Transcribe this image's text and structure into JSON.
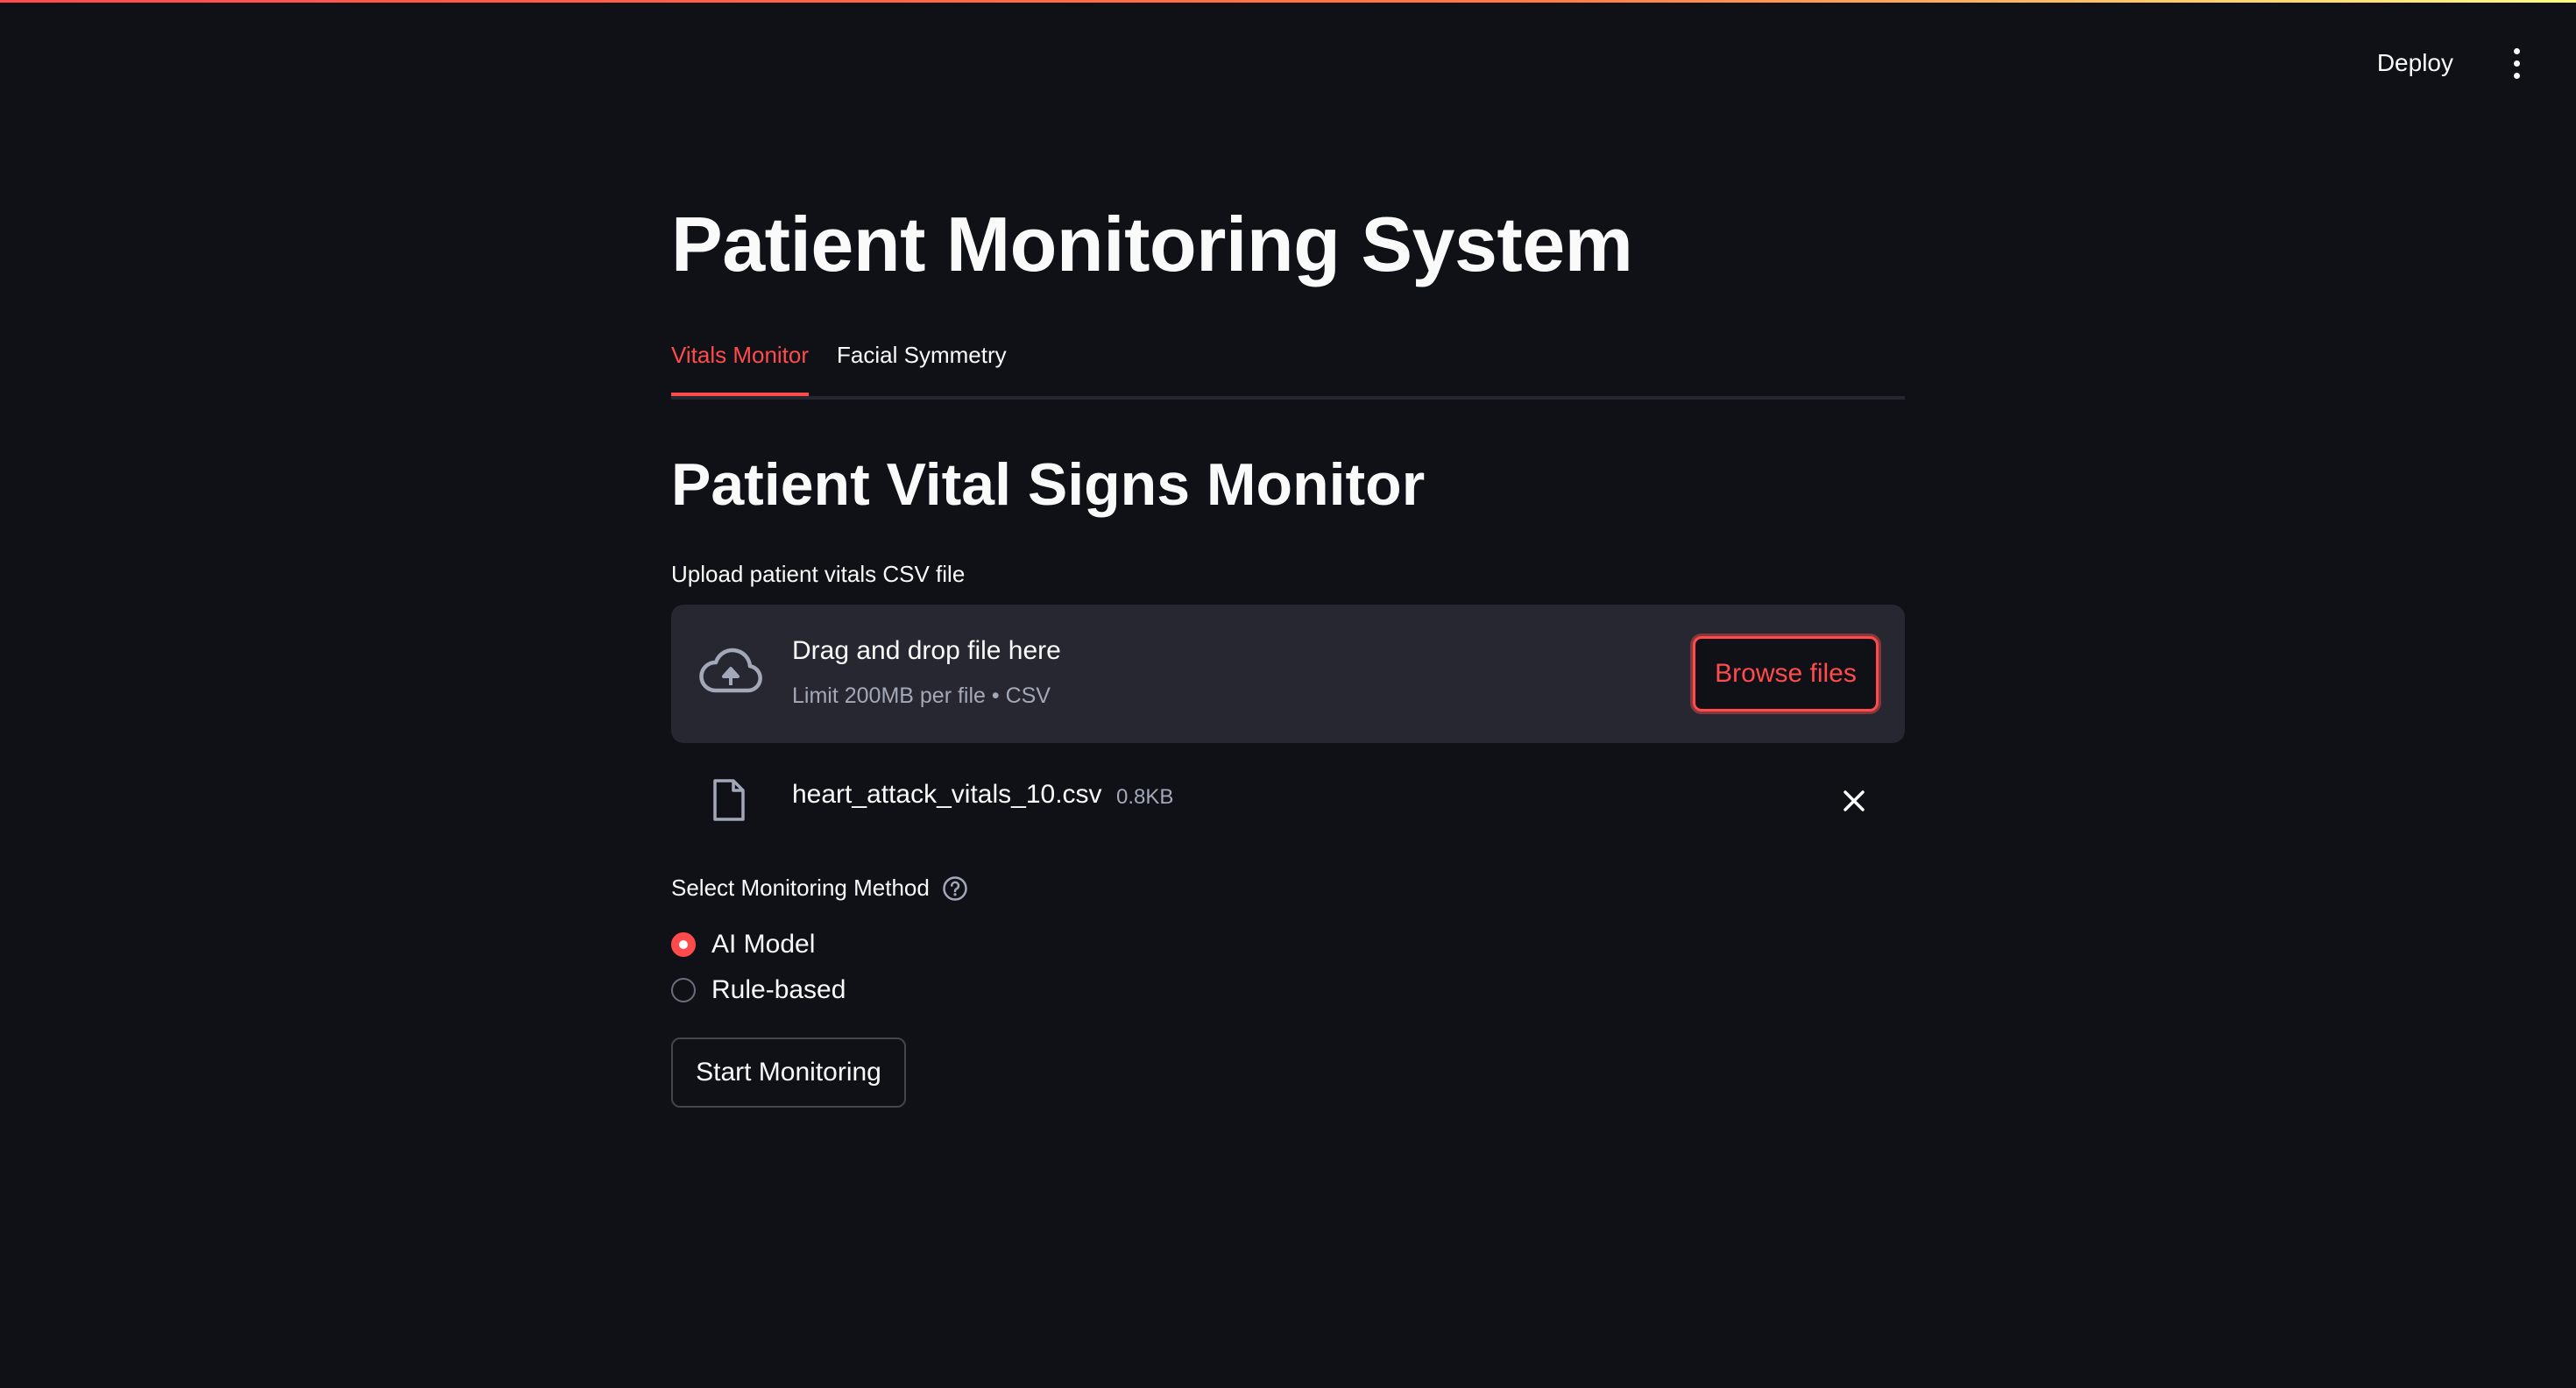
{
  "header": {
    "deploy_label": "Deploy",
    "menu_icon": "vertical-ellipsis-icon",
    "accent_gradient": [
      "#ff4b4b",
      "#fffd80"
    ]
  },
  "app": {
    "title": "Patient Monitoring System"
  },
  "tabs": [
    {
      "label": "Vitals Monitor",
      "active": true
    },
    {
      "label": "Facial Symmetry",
      "active": false
    }
  ],
  "vitals": {
    "section_title": "Patient Vital Signs Monitor",
    "uploader": {
      "label": "Upload patient vitals CSV file",
      "drop_title": "Drag and drop file here",
      "drop_subtitle": "Limit 200MB per file • CSV",
      "browse_label": "Browse files",
      "icon": "cloud-upload-icon"
    },
    "uploaded_file": {
      "name": "heart_attack_vitals_10.csv",
      "size": "0.8KB",
      "icon": "file-icon"
    },
    "method": {
      "label": "Select Monitoring Method",
      "options": [
        {
          "label": "AI Model",
          "selected": true
        },
        {
          "label": "Rule-based",
          "selected": false
        }
      ]
    },
    "start_button_label": "Start Monitoring"
  },
  "colors": {
    "background": "#0f1117",
    "accent": "#ff4b4b",
    "surface": "#262730",
    "muted_text": "#a3a8b8"
  }
}
